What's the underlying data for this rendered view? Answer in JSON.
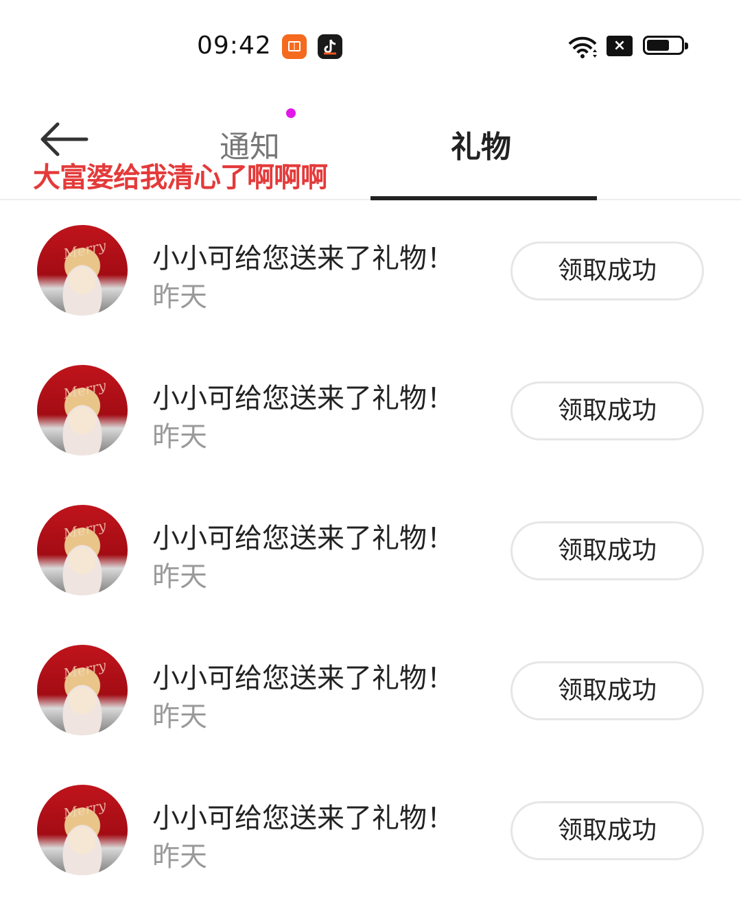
{
  "status_bar": {
    "time": "09:42",
    "icons": [
      "reader-app-icon",
      "tiktok-app-icon",
      "wifi-icon",
      "sim-absent-icon",
      "battery-icon"
    ]
  },
  "header": {
    "tabs": [
      {
        "label": "通知",
        "active": false,
        "has_dot": true
      },
      {
        "label": "礼物",
        "active": true
      }
    ],
    "overlay_caption": "大富婆给我清心了啊啊啊"
  },
  "gifts": [
    {
      "title": "小小可给您送来了礼物！",
      "time": "昨天",
      "button": "领取成功"
    },
    {
      "title": "小小可给您送来了礼物！",
      "time": "昨天",
      "button": "领取成功"
    },
    {
      "title": "小小可给您送来了礼物！",
      "time": "昨天",
      "button": "领取成功"
    },
    {
      "title": "小小可给您送来了礼物！",
      "time": "昨天",
      "button": "领取成功"
    },
    {
      "title": "小小可给您送来了礼物！",
      "time": "昨天",
      "button": "领取成功"
    }
  ],
  "colors": {
    "tab_dot": "#e019e8",
    "caption": "#e43a3a",
    "reader_icon": "#f56a1e"
  }
}
